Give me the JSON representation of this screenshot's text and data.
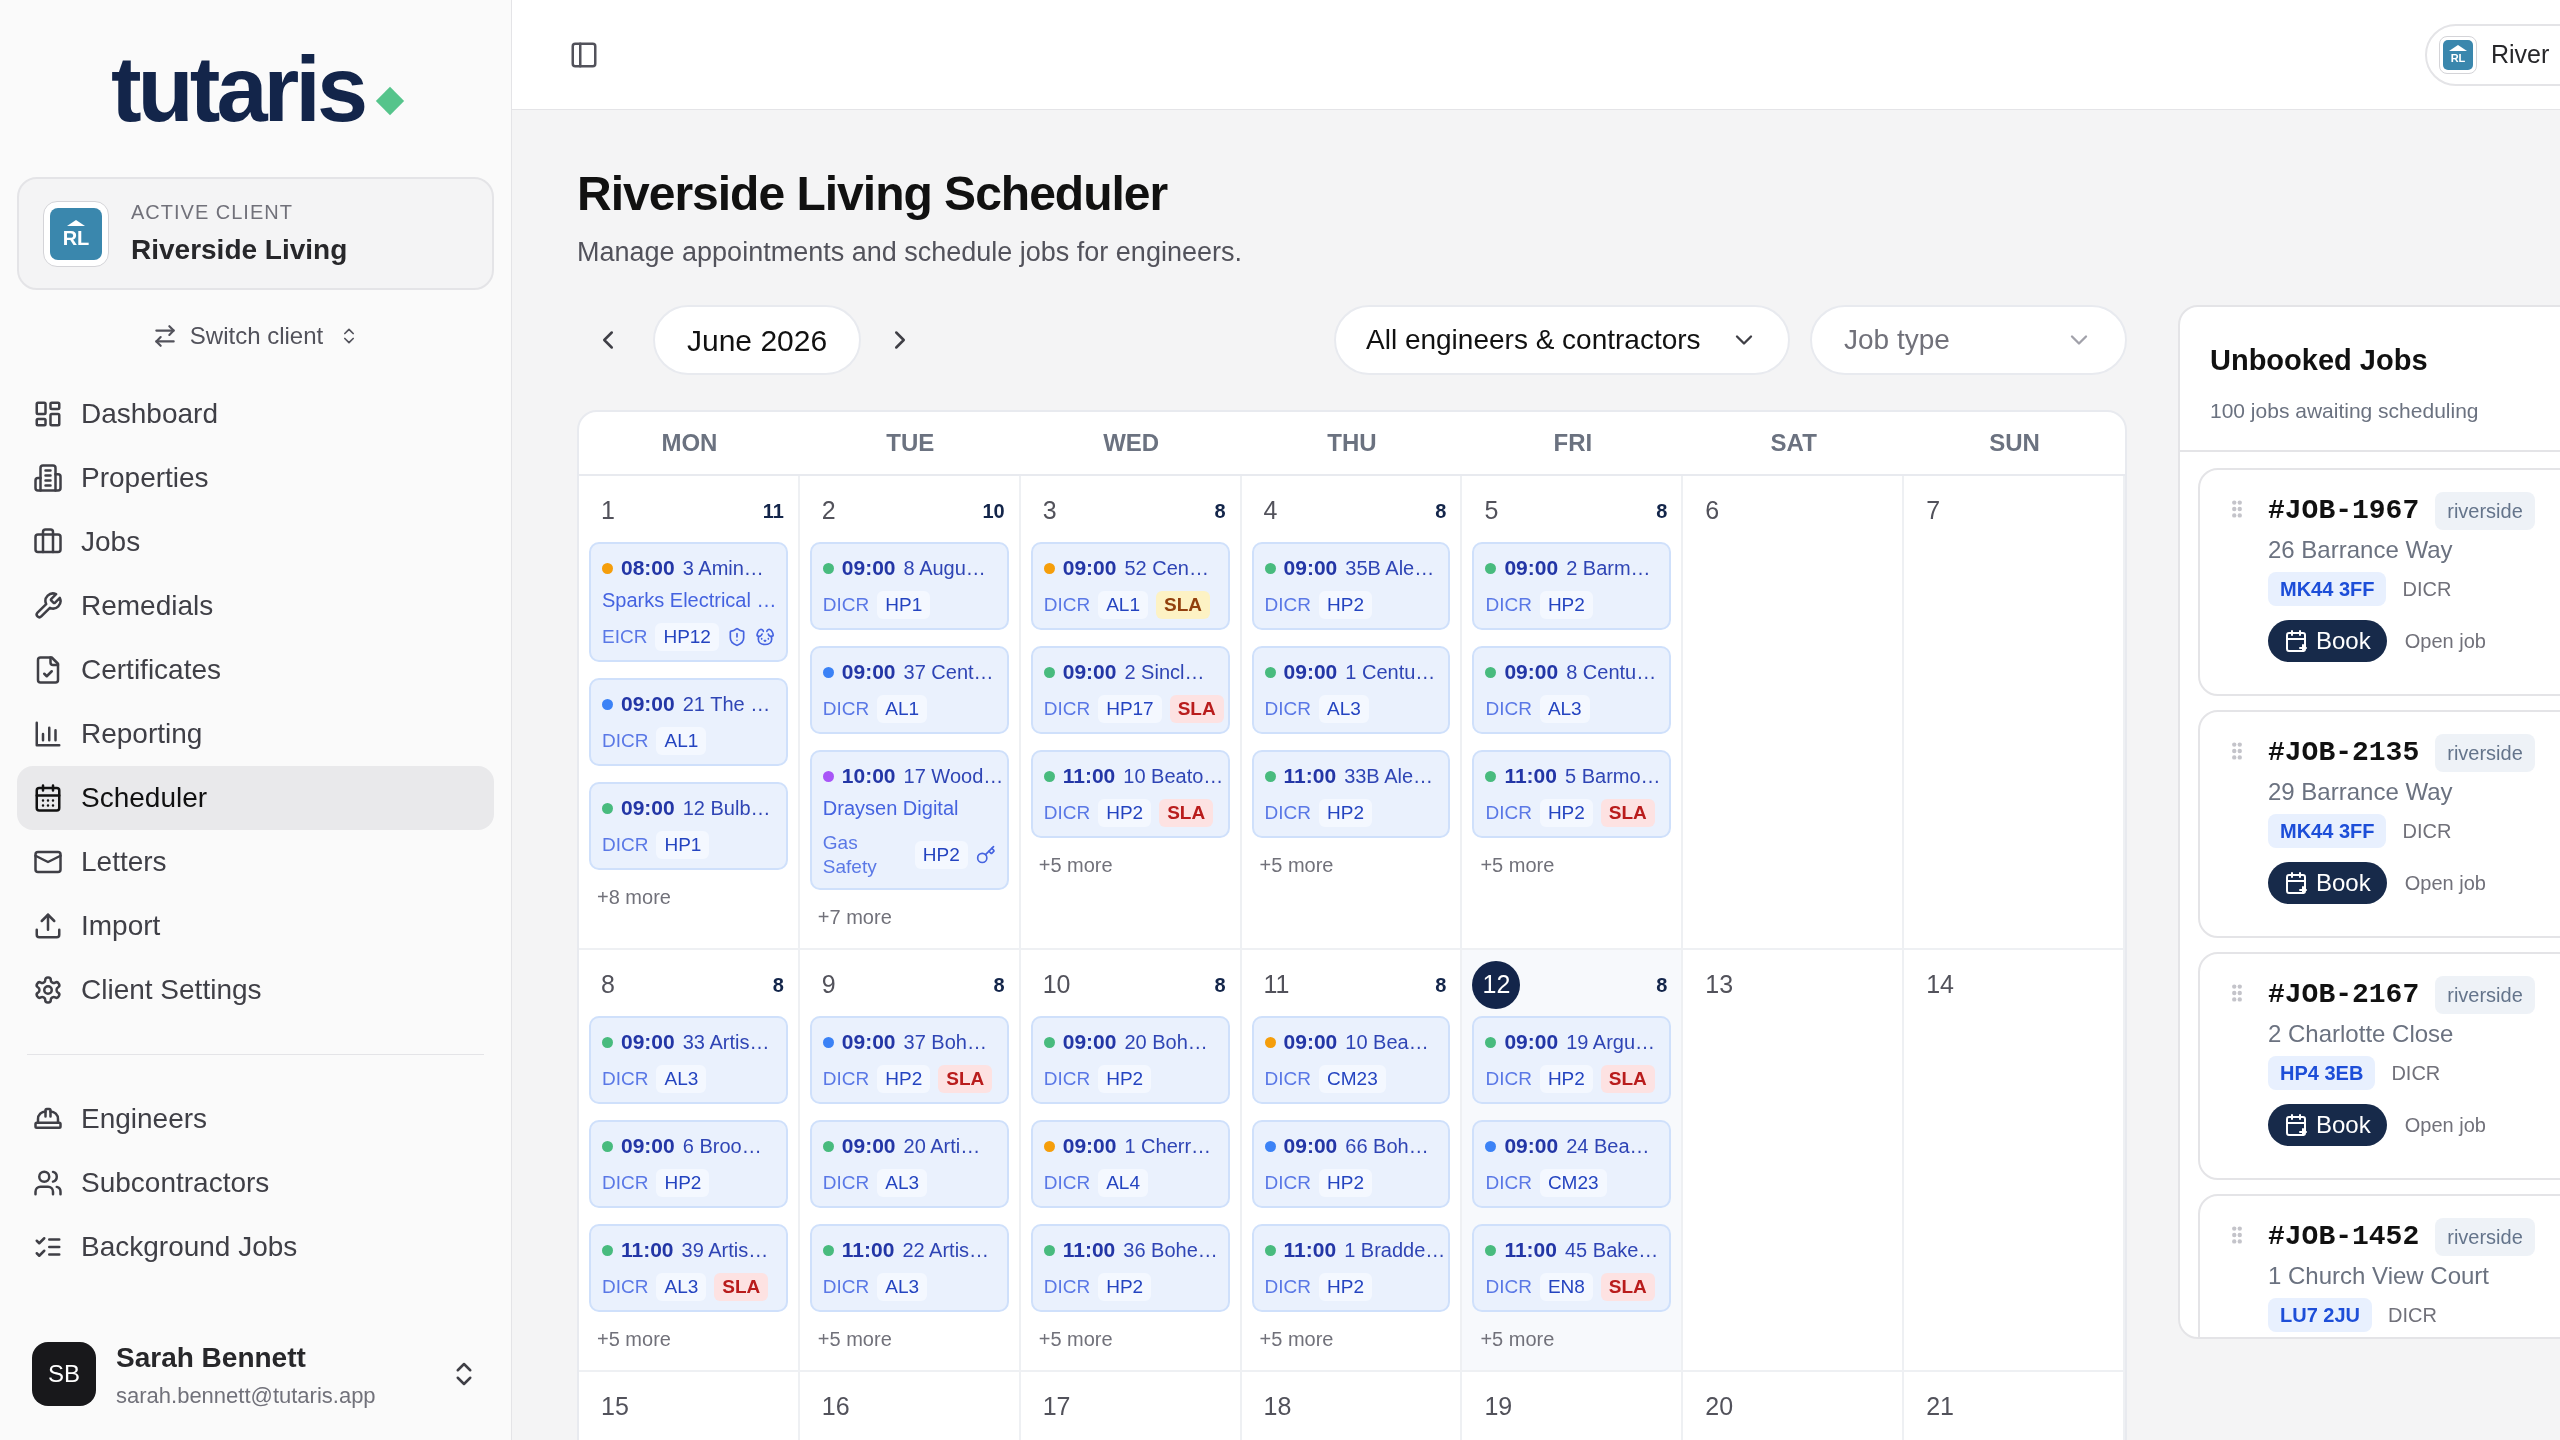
{
  "sidebar": {
    "logo": "tutaris",
    "active_client": {
      "label": "ACTIVE CLIENT",
      "name": "Riverside Living",
      "initials": "RL"
    },
    "switch_label": "Switch client",
    "nav": [
      {
        "label": "Dashboard",
        "selected": false
      },
      {
        "label": "Properties",
        "selected": false
      },
      {
        "label": "Jobs",
        "selected": false
      },
      {
        "label": "Remedials",
        "selected": false
      },
      {
        "label": "Certificates",
        "selected": false
      },
      {
        "label": "Reporting",
        "selected": false
      },
      {
        "label": "Scheduler",
        "selected": true
      },
      {
        "label": "Letters",
        "selected": false
      },
      {
        "label": "Import",
        "selected": false
      },
      {
        "label": "Client Settings",
        "selected": false
      }
    ],
    "nav_secondary": [
      {
        "label": "Engineers",
        "selected": false
      },
      {
        "label": "Subcontractors",
        "selected": false
      },
      {
        "label": "Background Jobs",
        "selected": false
      }
    ],
    "user": {
      "initials": "SB",
      "name": "Sarah Bennett",
      "email": "sarah.bennett@tutaris.app"
    }
  },
  "topbar": {
    "client_initials": "RL",
    "client_name": "River"
  },
  "header": {
    "title": "Riverside Living Scheduler",
    "subtitle": "Manage appointments and schedule jobs for engineers."
  },
  "toolbar": {
    "month": "June 2026",
    "engineer_filter": "All engineers & contractors",
    "job_type_placeholder": "Job type"
  },
  "calendar": {
    "weekdays": [
      "MON",
      "TUE",
      "WED",
      "THU",
      "FRI",
      "SAT",
      "SUN"
    ],
    "weeks": [
      {
        "days": [
          {
            "day": "1",
            "count": "11",
            "today": false,
            "more": "+8 more",
            "events": [
              {
                "color": "#f59e0b",
                "time": "08:00",
                "address": "3 Amin…",
                "contractor": "Sparks Electrical …",
                "type": "EICR",
                "area": "HP12",
                "alerts": {
                  "risk": true,
                  "pets": true
                }
              },
              {
                "color": "#3b82f6",
                "time": "09:00",
                "address": "21 The …",
                "type": "DICR",
                "area": "AL1"
              },
              {
                "color": "#48bb7e",
                "time": "09:00",
                "address": "12 Bulb…",
                "type": "DICR",
                "area": "HP1"
              }
            ]
          },
          {
            "day": "2",
            "count": "10",
            "today": false,
            "more": "+7 more",
            "events": [
              {
                "color": "#48bb7e",
                "time": "09:00",
                "address": "8 Augu…",
                "type": "DICR",
                "area": "HP1"
              },
              {
                "color": "#3b82f6",
                "time": "09:00",
                "address": "37 Cent…",
                "type": "DICR",
                "area": "AL1"
              },
              {
                "color": "#a855f7",
                "time": "10:00",
                "address": "17 Wood…",
                "contractor": "Draysen Digital",
                "type": "Gas Safety",
                "area": "HP2",
                "alerts": {
                  "keys": true
                }
              }
            ]
          },
          {
            "day": "3",
            "count": "8",
            "today": false,
            "more": "+5 more",
            "events": [
              {
                "color": "#f59e0b",
                "time": "09:00",
                "address": "52 Cen…",
                "type": "DICR",
                "area": "AL1",
                "sla": {
                  "label": "SLA",
                  "breach": false
                }
              },
              {
                "color": "#48bb7e",
                "time": "09:00",
                "address": "2 Sincl…",
                "type": "DICR",
                "area": "HP17",
                "sla": {
                  "label": "SLA",
                  "breach": true
                }
              },
              {
                "color": "#48bb7e",
                "time": "11:00",
                "address": "10 Beato…",
                "type": "DICR",
                "area": "HP2",
                "sla": {
                  "label": "SLA",
                  "breach": true
                }
              }
            ]
          },
          {
            "day": "4",
            "count": "8",
            "today": false,
            "more": "+5 more",
            "events": [
              {
                "color": "#48bb7e",
                "time": "09:00",
                "address": "35B Ale…",
                "type": "DICR",
                "area": "HP2"
              },
              {
                "color": "#48bb7e",
                "time": "09:00",
                "address": "1 Centu…",
                "type": "DICR",
                "area": "AL3"
              },
              {
                "color": "#48bb7e",
                "time": "11:00",
                "address": "33B Ale…",
                "type": "DICR",
                "area": "HP2"
              }
            ]
          },
          {
            "day": "5",
            "count": "8",
            "today": false,
            "more": "+5 more",
            "events": [
              {
                "color": "#48bb7e",
                "time": "09:00",
                "address": "2 Barm…",
                "type": "DICR",
                "area": "HP2"
              },
              {
                "color": "#48bb7e",
                "time": "09:00",
                "address": "8 Centu…",
                "type": "DICR",
                "area": "AL3"
              },
              {
                "color": "#48bb7e",
                "time": "11:00",
                "address": "5 Barmo…",
                "type": "DICR",
                "area": "HP2",
                "sla": {
                  "label": "SLA",
                  "breach": true
                }
              }
            ]
          },
          {
            "day": "6",
            "today": false
          },
          {
            "day": "7",
            "today": false
          }
        ]
      },
      {
        "days": [
          {
            "day": "8",
            "count": "8",
            "today": false,
            "more": "+5 more",
            "events": [
              {
                "color": "#48bb7e",
                "time": "09:00",
                "address": "33 Artis…",
                "type": "DICR",
                "area": "AL3"
              },
              {
                "color": "#48bb7e",
                "time": "09:00",
                "address": "6 Broo…",
                "type": "DICR",
                "area": "HP2"
              },
              {
                "color": "#48bb7e",
                "time": "11:00",
                "address": "39 Artis…",
                "type": "DICR",
                "area": "AL3",
                "sla": {
                  "label": "SLA",
                  "breach": true
                }
              }
            ]
          },
          {
            "day": "9",
            "count": "8",
            "today": false,
            "more": "+5 more",
            "events": [
              {
                "color": "#3b82f6",
                "time": "09:00",
                "address": "37 Boh…",
                "type": "DICR",
                "area": "HP2",
                "sla": {
                  "label": "SLA",
                  "breach": true
                }
              },
              {
                "color": "#48bb7e",
                "time": "09:00",
                "address": "20 Arti…",
                "type": "DICR",
                "area": "AL3"
              },
              {
                "color": "#48bb7e",
                "time": "11:00",
                "address": "22 Artis…",
                "type": "DICR",
                "area": "AL3"
              }
            ]
          },
          {
            "day": "10",
            "count": "8",
            "today": false,
            "more": "+5 more",
            "events": [
              {
                "color": "#48bb7e",
                "time": "09:00",
                "address": "20 Boh…",
                "type": "DICR",
                "area": "HP2"
              },
              {
                "color": "#f59e0b",
                "time": "09:00",
                "address": "1 Cherr…",
                "type": "DICR",
                "area": "AL4"
              },
              {
                "color": "#48bb7e",
                "time": "11:00",
                "address": "36 Bohe…",
                "type": "DICR",
                "area": "HP2"
              }
            ]
          },
          {
            "day": "11",
            "count": "8",
            "today": false,
            "more": "+5 more",
            "events": [
              {
                "color": "#f59e0b",
                "time": "09:00",
                "address": "10 Bea…",
                "type": "DICR",
                "area": "CM23"
              },
              {
                "color": "#3b82f6",
                "time": "09:00",
                "address": "66 Boh…",
                "type": "DICR",
                "area": "HP2"
              },
              {
                "color": "#48bb7e",
                "time": "11:00",
                "address": "1 Bradde…",
                "type": "DICR",
                "area": "HP2"
              }
            ]
          },
          {
            "day": "12",
            "count": "8",
            "today": true,
            "more": "+5 more",
            "events": [
              {
                "color": "#48bb7e",
                "time": "09:00",
                "address": "19 Argu…",
                "type": "DICR",
                "area": "HP2",
                "sla": {
                  "label": "SLA",
                  "breach": true
                }
              },
              {
                "color": "#3b82f6",
                "time": "09:00",
                "address": "24 Bea…",
                "type": "DICR",
                "area": "CM23"
              },
              {
                "color": "#48bb7e",
                "time": "11:00",
                "address": "45 Bake…",
                "type": "DICR",
                "area": "EN8",
                "sla": {
                  "label": "SLA",
                  "breach": true
                }
              }
            ]
          },
          {
            "day": "13",
            "today": false
          },
          {
            "day": "14",
            "today": false
          }
        ]
      },
      {
        "days": [
          {
            "day": "15",
            "today": false
          },
          {
            "day": "16",
            "today": false
          },
          {
            "day": "17",
            "today": false
          },
          {
            "day": "18",
            "today": false
          },
          {
            "day": "19",
            "today": false
          },
          {
            "day": "20",
            "today": false
          },
          {
            "day": "21",
            "today": false
          }
        ]
      }
    ]
  },
  "unbooked": {
    "title": "Unbooked Jobs",
    "subtitle": "100 jobs awaiting scheduling",
    "jobs": [
      {
        "id": "#JOB-1967",
        "tag": "riverside",
        "address": "26 Barrance Way",
        "postcode": "MK44 3FF",
        "type": "DICR",
        "book": "Book",
        "open": "Open job"
      },
      {
        "id": "#JOB-2135",
        "tag": "riverside",
        "address": "29 Barrance Way",
        "postcode": "MK44 3FF",
        "type": "DICR",
        "book": "Book",
        "open": "Open job"
      },
      {
        "id": "#JOB-2167",
        "tag": "riverside",
        "address": "2 Charlotte Close",
        "postcode": "HP4 3EB",
        "type": "DICR",
        "book": "Book",
        "open": "Open job"
      },
      {
        "id": "#JOB-1452",
        "tag": "riverside",
        "address": "1 Church View Court",
        "postcode": "LU7 2JU",
        "type": "DICR"
      }
    ]
  }
}
